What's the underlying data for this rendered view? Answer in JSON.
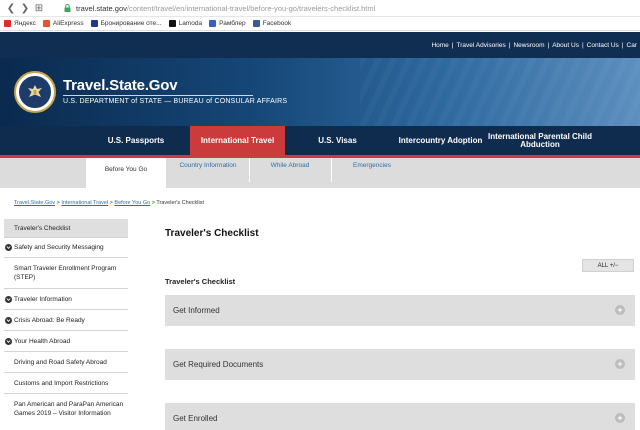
{
  "browser": {
    "url_host": "travel.state.gov",
    "url_path": "/content/travel/en/international-travel/before-you-go/travelers-checklist.html",
    "bookmarks": [
      {
        "label": "Яндекс",
        "color": "#e32b2b"
      },
      {
        "label": "AliExpress",
        "color": "#e9522a"
      },
      {
        "label": "Бронирование оте...",
        "color": "#1b3c8c"
      },
      {
        "label": "Lamoda",
        "color": "#111111"
      },
      {
        "label": "Рамблер",
        "color": "#3b5fc0"
      },
      {
        "label": "Facebook",
        "color": "#3b5998"
      }
    ]
  },
  "utility": {
    "links": [
      "Home",
      "Travel Advisories",
      "Newsroom",
      "About Us",
      "Contact Us",
      "Car"
    ]
  },
  "header": {
    "title": "Travel.State.Gov",
    "subtitle": "U.S. DEPARTMENT of STATE — BUREAU of CONSULAR AFFAIRS"
  },
  "mainnav": {
    "items": [
      {
        "label": "U.S. Passports"
      },
      {
        "label": "International Travel"
      },
      {
        "label": "U.S. Visas"
      },
      {
        "label": "Intercountry Adoption"
      },
      {
        "label": "International Parental Child Abduction"
      }
    ]
  },
  "subnav": {
    "items": [
      "Before You Go",
      "Country Information",
      "While Abroad",
      "Emergencies"
    ]
  },
  "breadcrumb": {
    "items": [
      "Travel.State.Gov",
      "International Travel",
      "Before You Go",
      "Traveler's Checklist"
    ],
    "separator": ">"
  },
  "sidebar": {
    "items": [
      {
        "label": "Traveler's Checklist"
      },
      {
        "label": "Safety and Security Messaging"
      },
      {
        "label": "Smart Traveler Enrollment Program (STEP)"
      },
      {
        "label": "Traveler Information"
      },
      {
        "label": "Crisis Abroad: Be Ready"
      },
      {
        "label": "Your Health Abroad"
      },
      {
        "label": "Driving and Road Safety Abroad"
      },
      {
        "label": "Customs and Import Restrictions"
      },
      {
        "label": "Pan American and ParaPan American Games 2019 – Visitor Information"
      }
    ]
  },
  "main": {
    "title": "Traveler's Checklist",
    "all_toggle": "ALL +/−",
    "section_heading": "Traveler's Checklist",
    "accordions": [
      "Get Informed",
      "Get Required Documents",
      "Get Enrolled"
    ],
    "expand_symbol": "+"
  },
  "colors": {
    "navy": "#102e52",
    "accent_red": "#cc3b3b",
    "link_blue": "#2c6fa8"
  }
}
